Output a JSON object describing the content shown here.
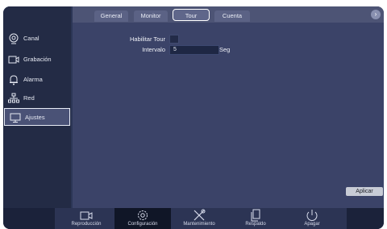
{
  "sidebar": {
    "items": [
      {
        "label": "Canal",
        "icon": "camera-lens-icon"
      },
      {
        "label": "Grabación",
        "icon": "video-record-icon"
      },
      {
        "label": "Alarma",
        "icon": "bell-icon"
      },
      {
        "label": "Red",
        "icon": "network-icon"
      },
      {
        "label": "Ajustes",
        "icon": "monitor-icon"
      }
    ],
    "active_index": 4
  },
  "tabs": [
    {
      "label": "General"
    },
    {
      "label": "Monitor"
    },
    {
      "label": "Tour"
    },
    {
      "label": "Cuenta"
    }
  ],
  "active_tab_index": 2,
  "form": {
    "enable_tour_label": "Habilitar Tour",
    "enable_tour_checked": false,
    "interval_label": "Intervalo",
    "interval_value": "5",
    "interval_unit": "Seg"
  },
  "apply_label": "Aplicar",
  "bottom": {
    "items": [
      {
        "label": "Reproducción",
        "icon": "playback-camera-icon"
      },
      {
        "label": "Configuración",
        "icon": "gear-icon"
      },
      {
        "label": "Mantenimiento",
        "icon": "tools-icon"
      },
      {
        "label": "Respaldo",
        "icon": "copy-files-icon"
      },
      {
        "label": "Apagar",
        "icon": "power-icon"
      }
    ],
    "active_index": 1
  },
  "colors": {
    "background": "#2c3656",
    "sidebar": "#232b45",
    "content": "#3b4368",
    "highlight_border": "#ffffff"
  }
}
